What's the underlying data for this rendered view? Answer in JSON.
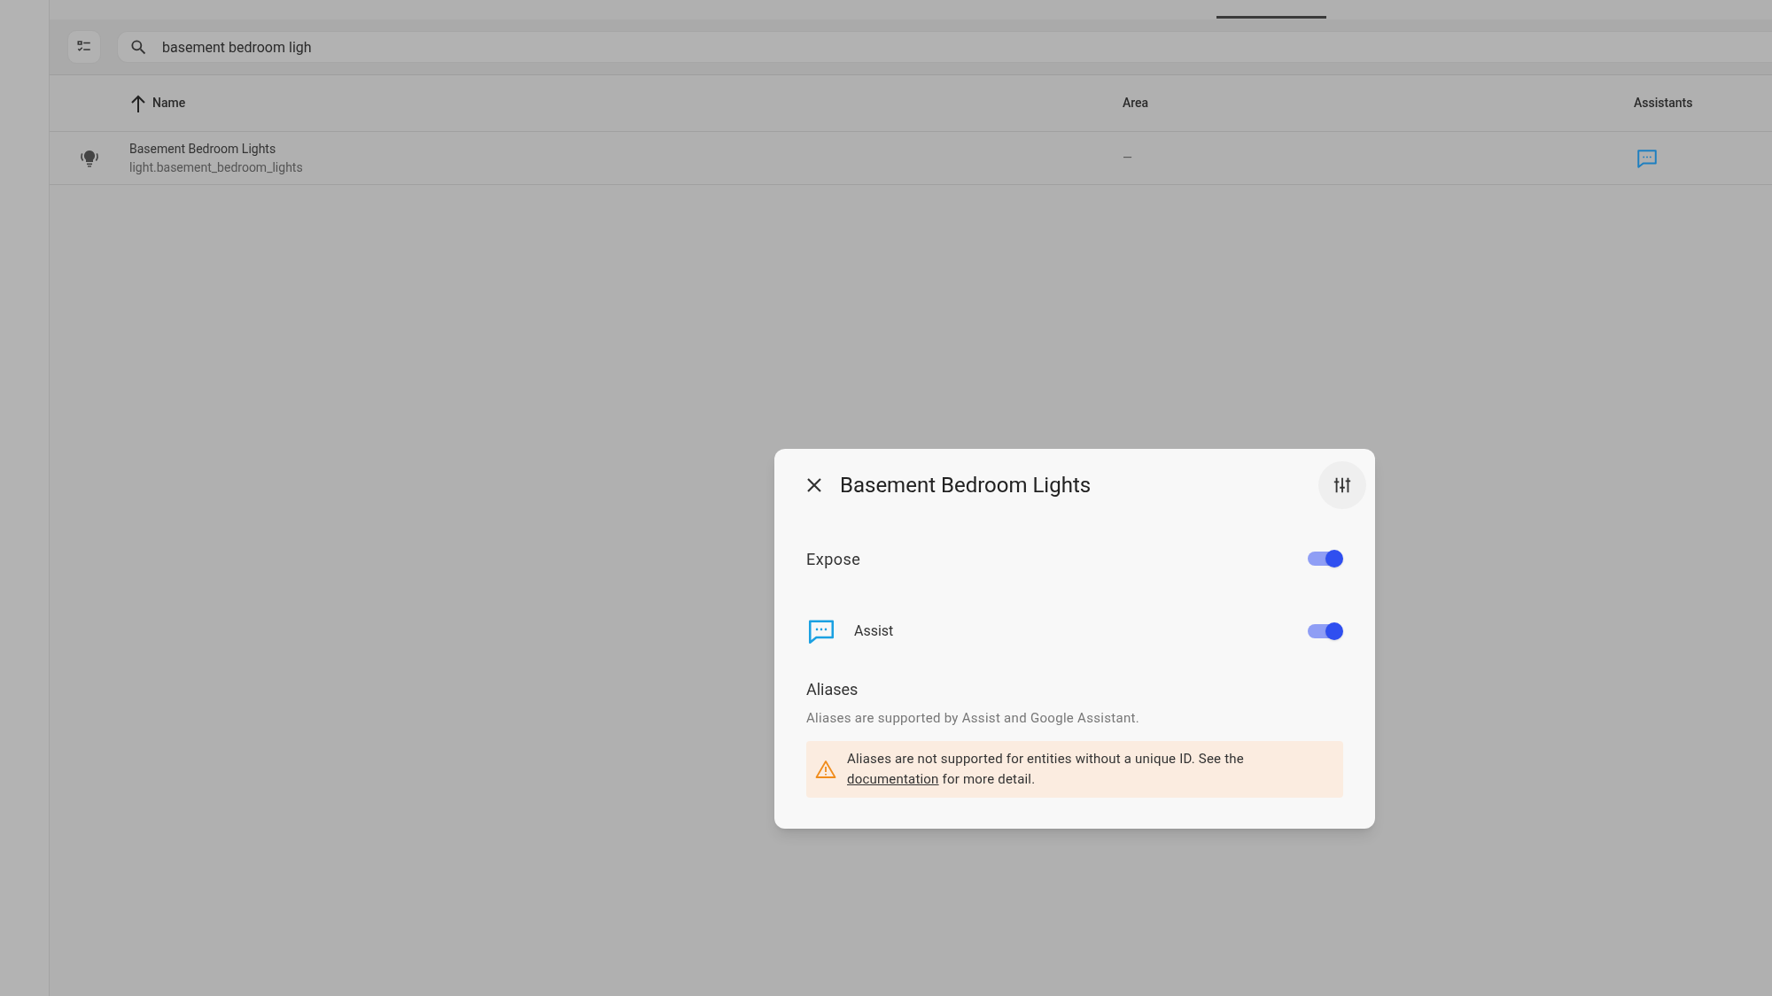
{
  "search": {
    "value": "basement bedroom ligh"
  },
  "table": {
    "columns": [
      {
        "label": "Name",
        "sorted": true
      },
      {
        "label": "Area",
        "sorted": false
      },
      {
        "label": "Assistants",
        "sorted": false
      }
    ],
    "rows": [
      {
        "name": "Basement Bedroom Lights",
        "entity_id": "light.basement_bedroom_lights",
        "area": "—"
      }
    ]
  },
  "dialog": {
    "title": "Basement Bedroom Lights",
    "expose": {
      "label": "Expose",
      "on": true
    },
    "assistants": [
      {
        "label": "Assist",
        "on": true
      }
    ],
    "aliases": {
      "heading": "Aliases",
      "description": "Aliases are supported by Assist and Google Assistant.",
      "warning": {
        "before": "Aliases are not supported for entities without a unique ID. See the",
        "link": "documentation",
        "after": "for more detail."
      }
    }
  }
}
